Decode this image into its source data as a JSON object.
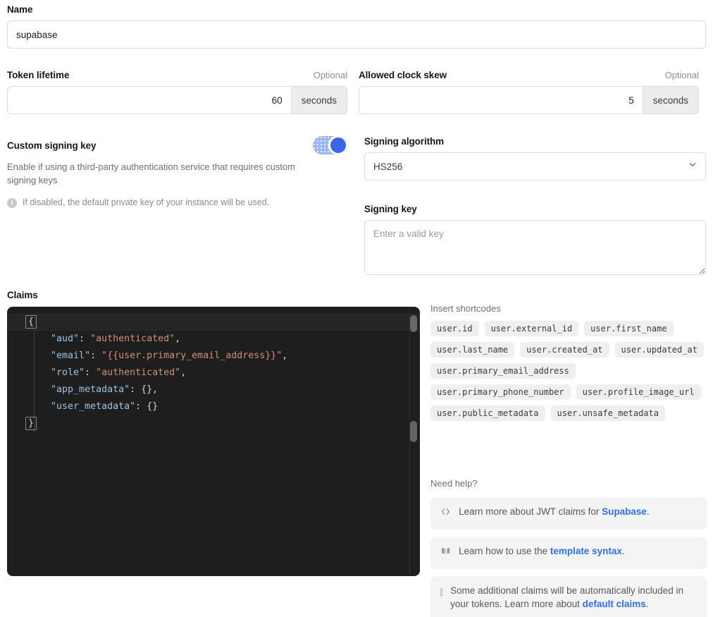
{
  "name_field": {
    "label": "Name",
    "value": "supabase"
  },
  "token_lifetime": {
    "label": "Token lifetime",
    "optional": "Optional",
    "value": "60",
    "unit": "seconds"
  },
  "clock_skew": {
    "label": "Allowed clock skew",
    "optional": "Optional",
    "value": "5",
    "unit": "seconds"
  },
  "custom_signing_key": {
    "label": "Custom signing key",
    "description": "Enable if using a third-party authentication service that requires custom signing keys",
    "note": "If disabled, the default private key of your instance will be used.",
    "enabled": true,
    "accent": "#3b64e8"
  },
  "signing_algorithm": {
    "label": "Signing algorithm",
    "value": "HS256",
    "options": [
      "HS256"
    ]
  },
  "signing_key": {
    "label": "Signing key",
    "value": "",
    "placeholder": "Enter a valid key"
  },
  "claims": {
    "label": "Claims",
    "lines": [
      {
        "indent": 0,
        "parts": [
          {
            "t": "{",
            "c": "bracket"
          }
        ]
      },
      {
        "indent": 1,
        "parts": [
          {
            "t": "\"aud\"",
            "c": "k"
          },
          {
            "t": ": ",
            "c": "p"
          },
          {
            "t": "\"authenticated\"",
            "c": "s"
          },
          {
            "t": ",",
            "c": "p"
          }
        ]
      },
      {
        "indent": 1,
        "parts": [
          {
            "t": "\"email\"",
            "c": "k"
          },
          {
            "t": ": ",
            "c": "p"
          },
          {
            "t": "\"{{user.primary_email_address}}\"",
            "c": "s"
          },
          {
            "t": ",",
            "c": "p"
          }
        ]
      },
      {
        "indent": 1,
        "parts": [
          {
            "t": "\"role\"",
            "c": "k"
          },
          {
            "t": ": ",
            "c": "p"
          },
          {
            "t": "\"authenticated\"",
            "c": "s"
          },
          {
            "t": ",",
            "c": "p"
          }
        ]
      },
      {
        "indent": 1,
        "parts": [
          {
            "t": "\"app_metadata\"",
            "c": "k"
          },
          {
            "t": ": {},",
            "c": "p"
          }
        ]
      },
      {
        "indent": 1,
        "parts": [
          {
            "t": "\"user_metadata\"",
            "c": "k"
          },
          {
            "t": ": {}",
            "c": "p"
          }
        ]
      },
      {
        "indent": 0,
        "parts": [
          {
            "t": "}",
            "c": "bracket"
          }
        ]
      }
    ],
    "raw": "{\n    \"aud\": \"authenticated\",\n    \"email\": \"{{user.primary_email_address}}\",\n    \"role\": \"authenticated\",\n    \"app_metadata\": {},\n    \"user_metadata\": {}\n}"
  },
  "shortcodes": {
    "label": "Insert shortcodes",
    "items": [
      "user.id",
      "user.external_id",
      "user.first_name",
      "user.last_name",
      "user.created_at",
      "user.updated_at",
      "user.primary_email_address",
      "user.primary_phone_number",
      "user.profile_image_url",
      "user.public_metadata",
      "user.unsafe_metadata"
    ]
  },
  "need_help": {
    "label": "Need help?",
    "cards": [
      {
        "icon": "code-icon",
        "before": "Learn more about JWT claims for ",
        "link": "Supabase",
        "after": "."
      },
      {
        "icon": "book-icon",
        "before": "Learn how to use the ",
        "link": "template syntax",
        "after": "."
      },
      {
        "icon": "info-icon",
        "before": "Some additional claims will be automatically included in your tokens. Learn more about ",
        "link": "default claims",
        "after": "."
      }
    ]
  }
}
